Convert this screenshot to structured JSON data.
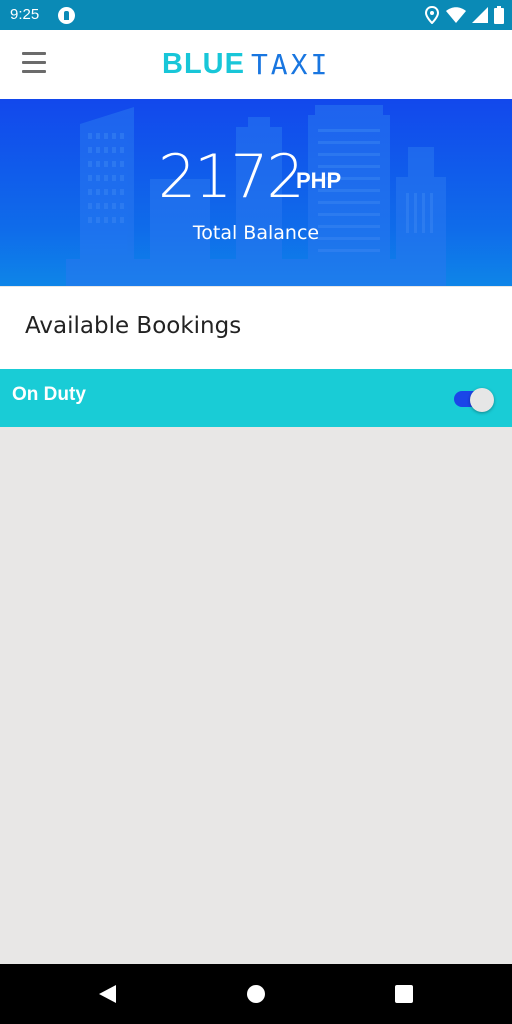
{
  "status_bar": {
    "time": "9:25"
  },
  "app_bar": {
    "logo_part1": "BLUE",
    "logo_part2": "TAXI"
  },
  "balance": {
    "amount": "2172",
    "currency": "PHP",
    "label": "Total Balance"
  },
  "bookings": {
    "title": "Available Bookings"
  },
  "duty": {
    "label": "On Duty",
    "enabled": true
  },
  "colors": {
    "status_bar": "#0a8ab6",
    "hero": "#1248ec",
    "accent": "#19ccd6",
    "toggle_track": "#1a46e8"
  }
}
